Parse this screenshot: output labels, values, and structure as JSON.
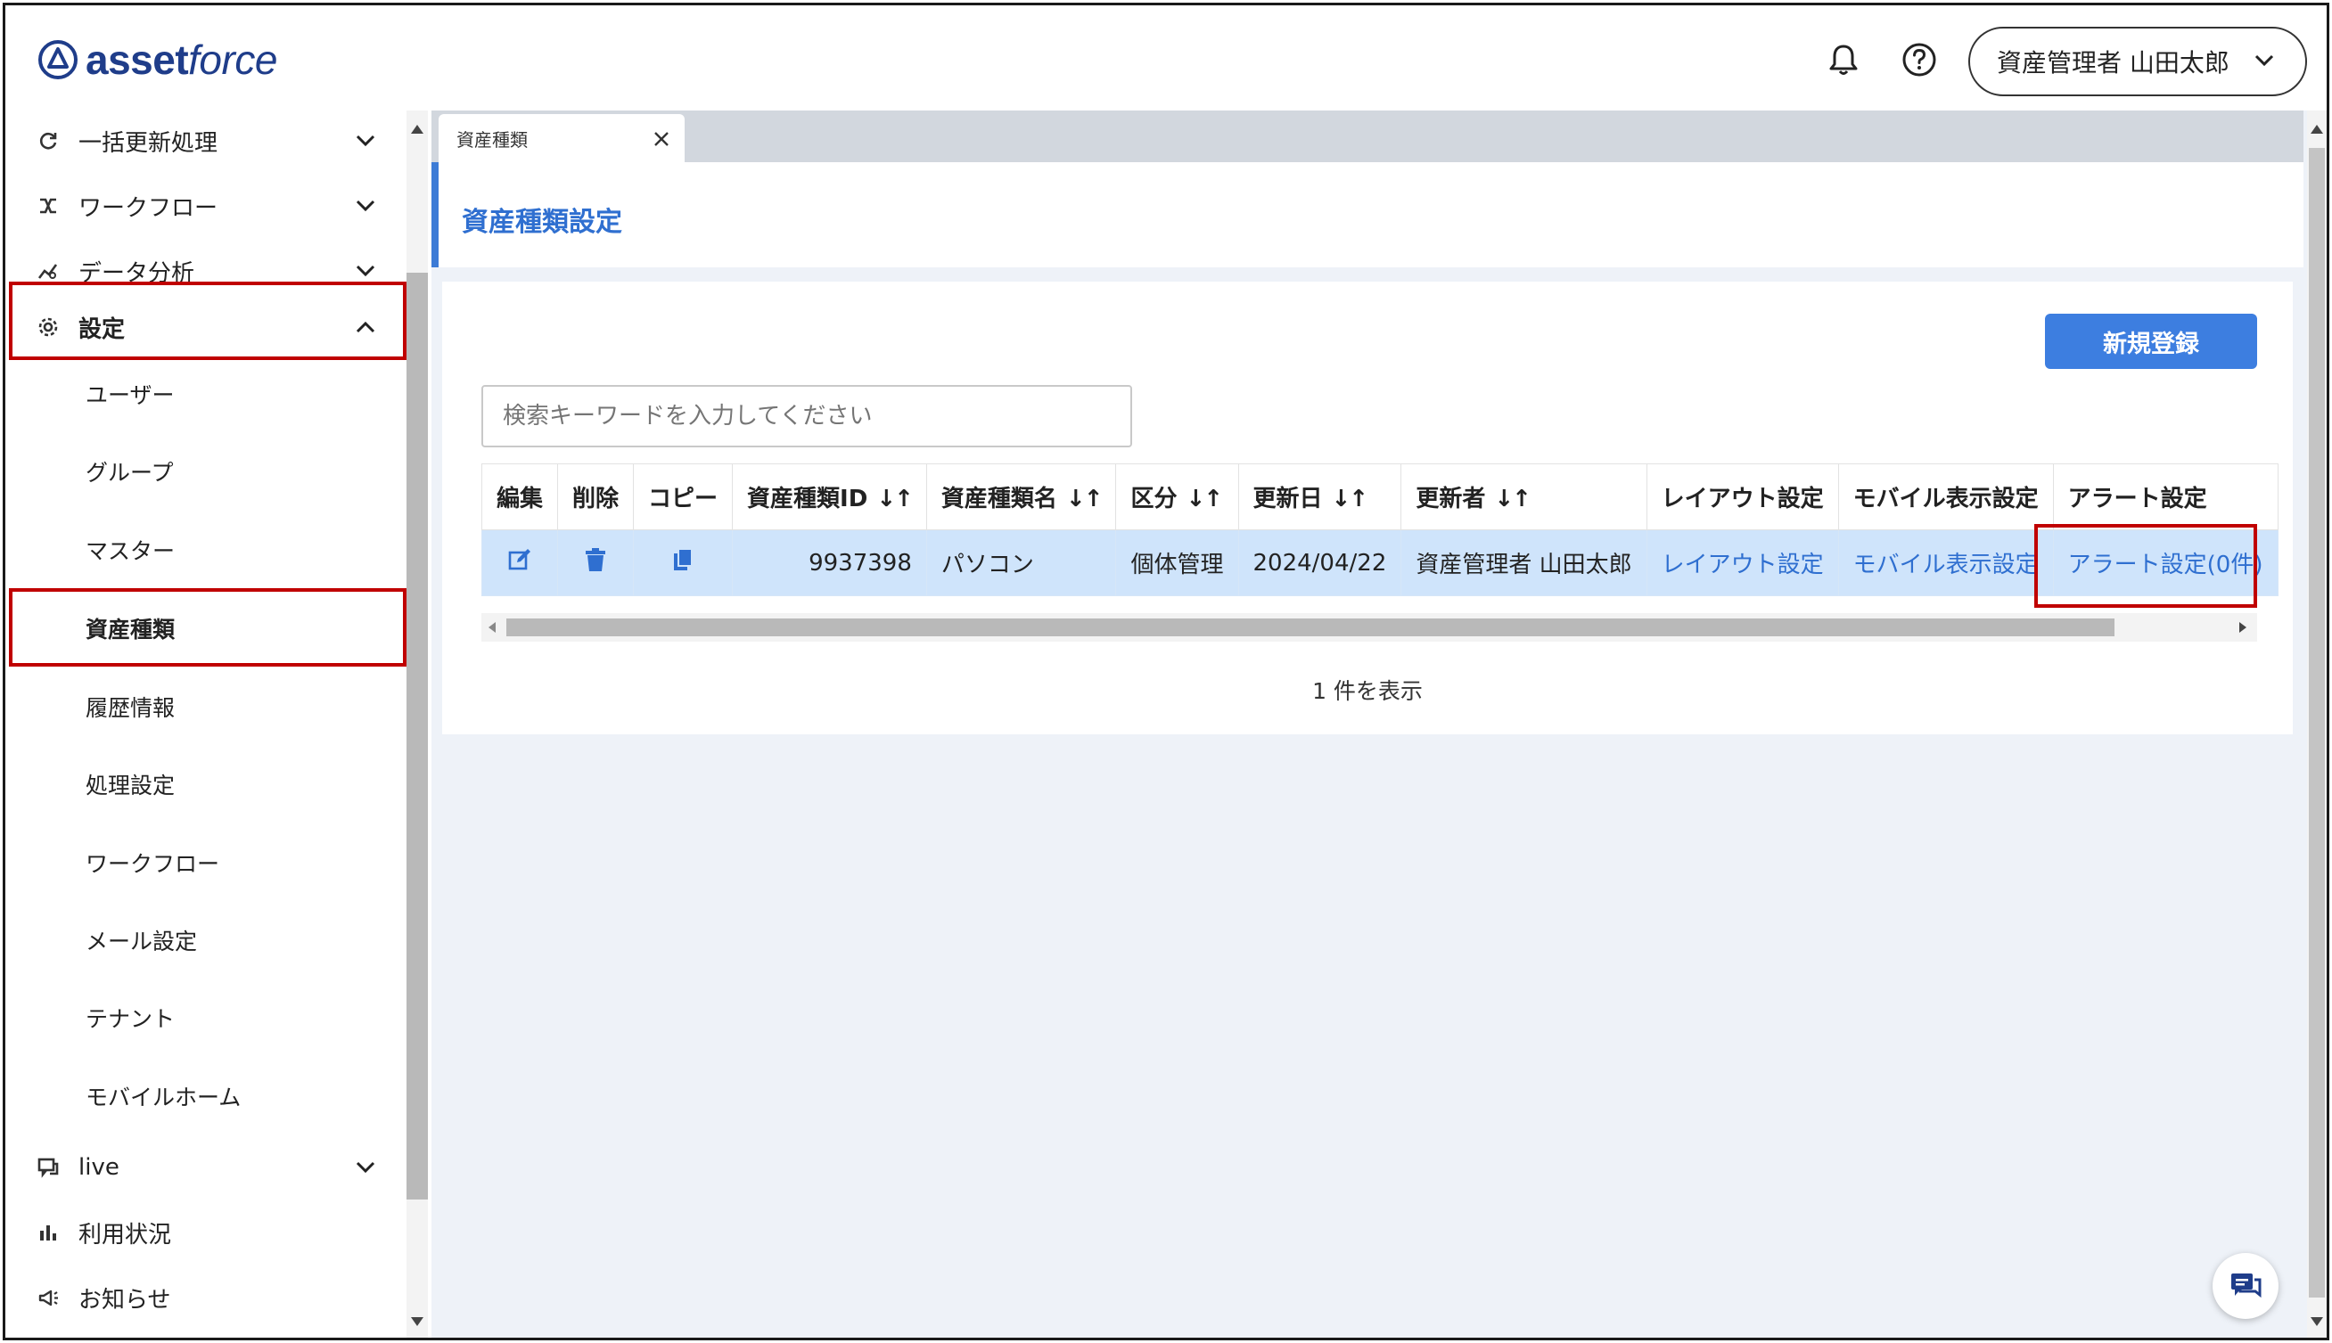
{
  "app": {
    "brand_bold": "asset",
    "brand_light": "force"
  },
  "header": {
    "user_label": "資産管理者 山田太郎"
  },
  "sidebar": {
    "items_top": [
      {
        "label": "一括更新処理",
        "icon": "refresh-icon"
      },
      {
        "label": "ワークフロー",
        "icon": "workflow-icon"
      },
      {
        "label": "データ分析",
        "icon": "analytics-icon"
      },
      {
        "label": "設定",
        "icon": "gear-icon",
        "expanded": true
      }
    ],
    "settings_sub": [
      "ユーザー",
      "グループ",
      "マスター",
      "資産種類",
      "履歴情報",
      "処理設定",
      "ワークフロー",
      "メール設定",
      "テナント",
      "モバイルホーム"
    ],
    "active_sub": "資産種類",
    "items_bottom": [
      {
        "label": "live",
        "icon": "live-icon"
      },
      {
        "label": "利用状況",
        "icon": "bar-chart-icon"
      },
      {
        "label": "お知らせ",
        "icon": "megaphone-icon"
      }
    ]
  },
  "tabs": [
    {
      "label": "資産種類"
    }
  ],
  "page": {
    "title": "資産種類設定",
    "new_button": "新規登録",
    "search_placeholder": "検索キーワードを入力してください",
    "columns": [
      "編集",
      "削除",
      "コピー",
      "資産種類ID",
      "資産種類名",
      "区分",
      "更新日",
      "更新者",
      "レイアウト設定",
      "モバイル表示設定",
      "アラート設定"
    ],
    "rows": [
      {
        "id": "9937398",
        "name": "パソコン",
        "category": "個体管理",
        "updated": "2024/04/22",
        "updater": "資産管理者 山田太郎",
        "layout": "レイアウト設定",
        "mobile": "モバイル表示設定",
        "alert": "アラート設定(0件)"
      }
    ],
    "count_text": "1 件を表示"
  },
  "colors": {
    "accent": "#3c7bd6",
    "highlight_row": "#cfe4fb",
    "annotation": "#c00000",
    "brand": "#1f3d8a"
  }
}
